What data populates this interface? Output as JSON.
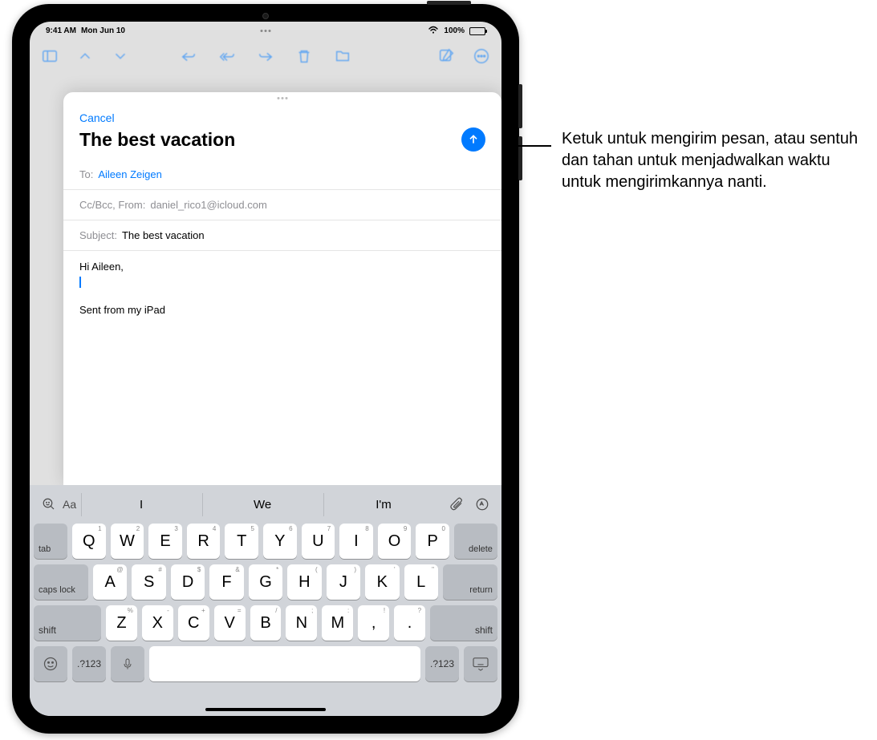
{
  "status": {
    "time": "9:41 AM",
    "date": "Mon Jun 10",
    "battery_pct": "100%"
  },
  "compose": {
    "cancel": "Cancel",
    "title": "The best vacation",
    "to_label": "To:",
    "to_value": "Aileen Zeigen",
    "ccbcc_label": "Cc/Bcc, From:",
    "from_value": "daniel_rico1@icloud.com",
    "subject_label": "Subject:",
    "subject_value": "The best vacation",
    "body_greeting": "Hi Aileen,",
    "body_signature": "Sent from my iPad"
  },
  "suggestions": {
    "aa": "Aa",
    "s1": "I",
    "s2": "We",
    "s3": "I'm"
  },
  "keys": {
    "row1": [
      {
        "main": "Q",
        "sub": "1"
      },
      {
        "main": "W",
        "sub": "2"
      },
      {
        "main": "E",
        "sub": "3"
      },
      {
        "main": "R",
        "sub": "4"
      },
      {
        "main": "T",
        "sub": "5"
      },
      {
        "main": "Y",
        "sub": "6"
      },
      {
        "main": "U",
        "sub": "7"
      },
      {
        "main": "I",
        "sub": "8"
      },
      {
        "main": "O",
        "sub": "9"
      },
      {
        "main": "P",
        "sub": "0"
      }
    ],
    "row2": [
      {
        "main": "A",
        "sub": "@"
      },
      {
        "main": "S",
        "sub": "#"
      },
      {
        "main": "D",
        "sub": "$"
      },
      {
        "main": "F",
        "sub": "&"
      },
      {
        "main": "G",
        "sub": "*"
      },
      {
        "main": "H",
        "sub": "("
      },
      {
        "main": "J",
        "sub": ")"
      },
      {
        "main": "K",
        "sub": "'"
      },
      {
        "main": "L",
        "sub": "\""
      }
    ],
    "row3": [
      {
        "main": "Z",
        "sub": "%"
      },
      {
        "main": "X",
        "sub": "-"
      },
      {
        "main": "C",
        "sub": "+"
      },
      {
        "main": "V",
        "sub": "="
      },
      {
        "main": "B",
        "sub": "/"
      },
      {
        "main": "N",
        "sub": ";"
      },
      {
        "main": "M",
        "sub": ":"
      },
      {
        "main": ",",
        "sub": "!"
      },
      {
        "main": ".",
        "sub": "?"
      }
    ],
    "tab": "tab",
    "delete": "delete",
    "caps": "caps lock",
    "return": "return",
    "shift": "shift",
    "num": ".?123"
  },
  "callout": {
    "text": "Ketuk untuk mengirim pesan, atau sentuh dan tahan untuk menjadwalkan waktu untuk mengirimkannya nanti."
  }
}
